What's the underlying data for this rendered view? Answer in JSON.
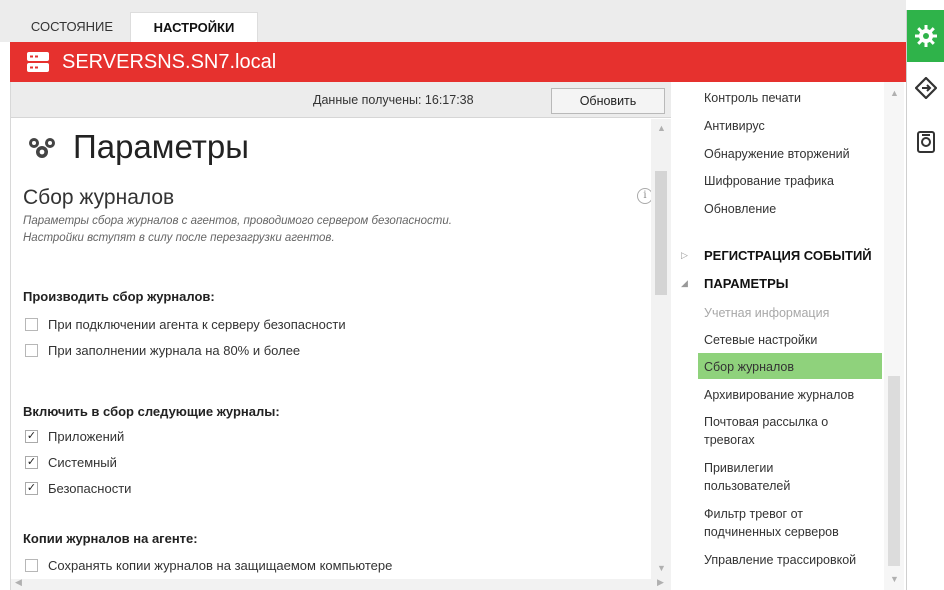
{
  "tabs": [
    {
      "label": "СОСТОЯНИЕ",
      "active": false
    },
    {
      "label": "НАСТРОЙКИ",
      "active": true
    }
  ],
  "server": {
    "name": "SERVERSNS.SN7.local",
    "icon": "server-icon",
    "color": "#e6312e"
  },
  "infobar": {
    "received": "Данные получены:  16:17:38",
    "refresh_label": "Обновить"
  },
  "page": {
    "icon": "settings-group-icon",
    "title": "Параметры",
    "section_title": "Сбор журналов",
    "description_line1": "Параметры сбора журналов с агентов, проводимого сервером безопасности.",
    "description_line2": "Настройки вступят в силу после перезагрузки агентов."
  },
  "groups": {
    "collect": {
      "heading": "Производить сбор журналов:",
      "options": [
        {
          "label": "При подключении агента к серверу безопасности",
          "checked": false
        },
        {
          "label": "При заполнении журнала на 80% и более",
          "checked": false
        }
      ]
    },
    "include": {
      "heading": "Включить в сбор следующие журналы:",
      "options": [
        {
          "label": "Приложений",
          "checked": true
        },
        {
          "label": "Системный",
          "checked": true
        },
        {
          "label": "Безопасности",
          "checked": true
        }
      ]
    },
    "copies": {
      "heading": "Копии журналов на агенте:",
      "options": [
        {
          "label": "Сохранять копии журналов на защищаемом компьютере",
          "checked": false
        }
      ]
    }
  },
  "nav": {
    "items_top": [
      "Контроль печати",
      "Антивирус",
      "Обнаружение вторжений",
      "Шифрование трафика",
      "Обновление"
    ],
    "head_events": "РЕГИСТРАЦИЯ СОБЫТИЙ",
    "head_params": "ПАРАМЕТРЫ",
    "params_items": [
      {
        "label": "Учетная информация",
        "dim": true
      },
      {
        "label": "Сетевые настройки"
      },
      {
        "label": "Сбор журналов",
        "selected": true
      },
      {
        "label": "Архивирование журналов"
      },
      {
        "label_1": "Почтовая рассылка о",
        "label_2": "тревогах"
      },
      {
        "label_1": "Привилегии",
        "label_2": "пользователей"
      },
      {
        "label_1": "Фильтр тревог от",
        "label_2": "подчиненных серверов"
      },
      {
        "label": "Управление трассировкой"
      }
    ],
    "selected_color": "#8fd27c"
  },
  "toolbar": {
    "icons": [
      "gear-icon",
      "navigate-icon",
      "device-icon"
    ],
    "accent": "#2fb34a"
  }
}
